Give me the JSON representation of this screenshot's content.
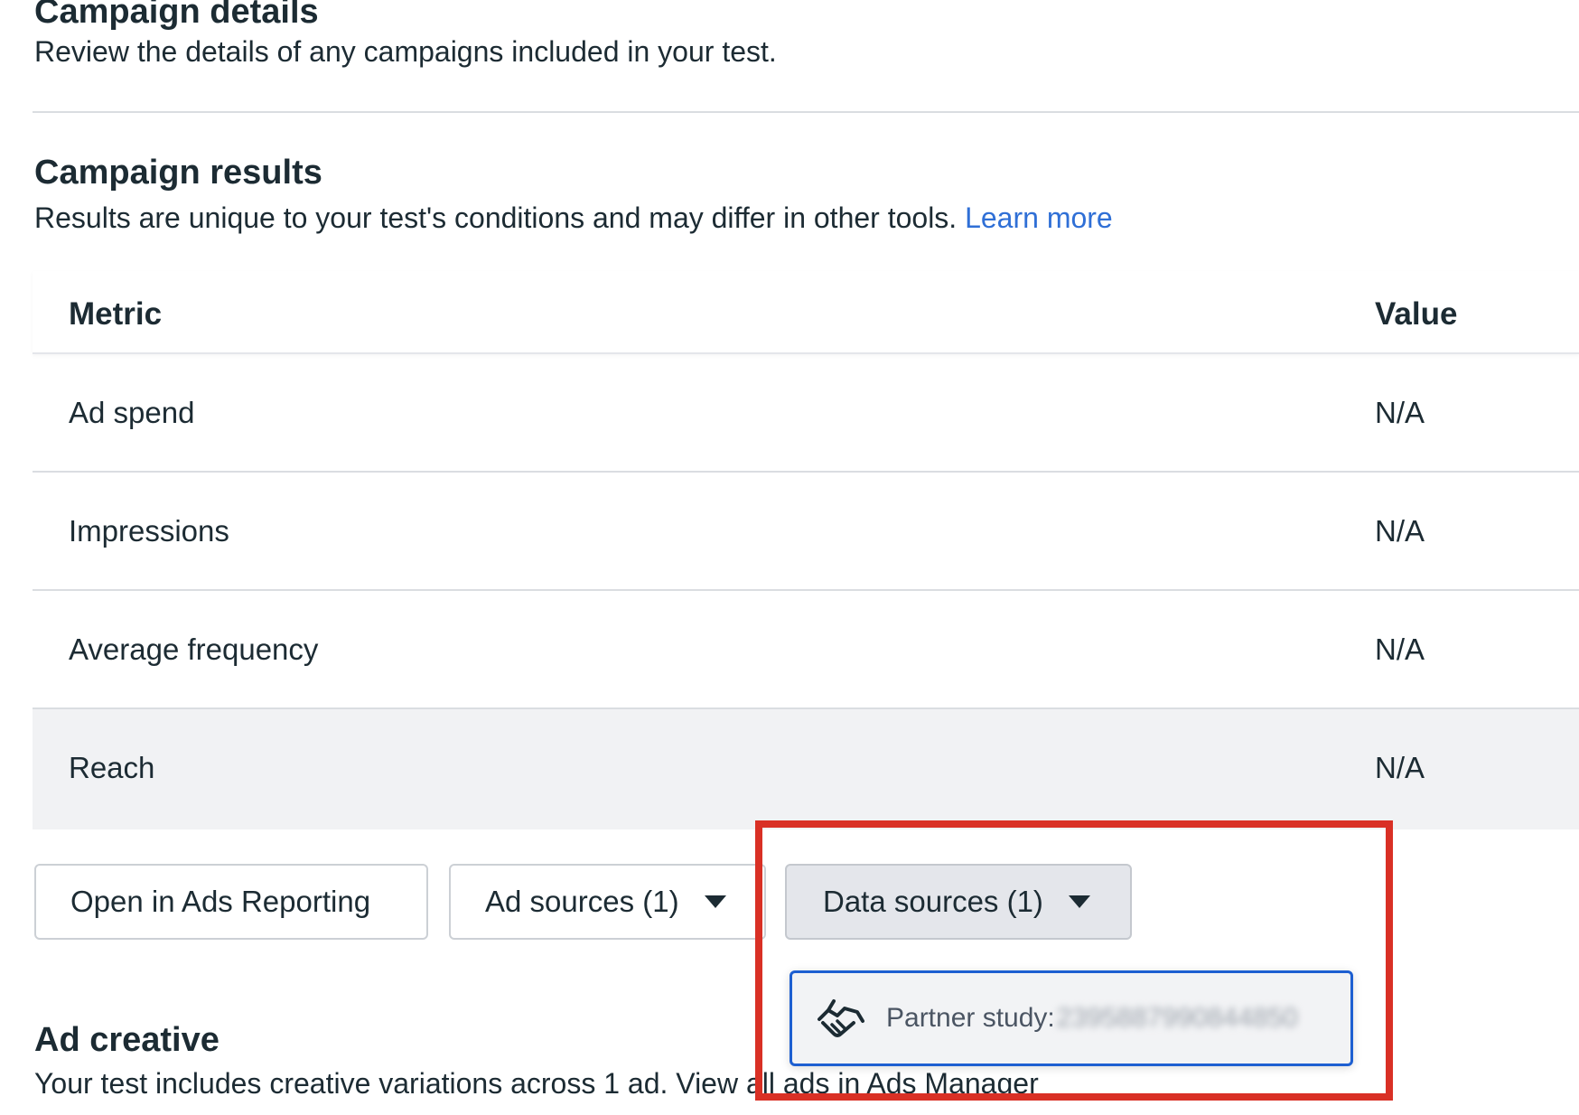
{
  "campaign_details": {
    "title": "Campaign details",
    "subtitle": "Review the details of any campaigns included in your test."
  },
  "campaign_results": {
    "title": "Campaign results",
    "subtitle": "Results are unique to your test's conditions and may differ in other tools.",
    "learn_more": "Learn more",
    "table": {
      "headers": {
        "metric": "Metric",
        "value": "Value"
      },
      "rows": [
        {
          "metric": "Ad spend",
          "value": "N/A"
        },
        {
          "metric": "Impressions",
          "value": "N/A"
        },
        {
          "metric": "Average frequency",
          "value": "N/A"
        },
        {
          "metric": "Reach",
          "value": "N/A"
        }
      ]
    }
  },
  "actions": {
    "open_reporting": "Open in Ads Reporting",
    "ad_sources": "Ad sources (1)",
    "data_sources": "Data sources (1)"
  },
  "data_sources_menu": {
    "item_label": "Partner study: ",
    "item_id_redacted": "2395887990844850",
    "item_icon": "handshake-icon"
  },
  "ad_creative": {
    "title": "Ad creative",
    "subtitle_prefix": "Your test includes creative variations across 1 ad. ",
    "view_all_link": "View all ads in Ads Manager"
  },
  "colors": {
    "accent_link": "#2f6fd6",
    "dropdown_border": "#1d5fd1",
    "annotation_red": "#d93025"
  }
}
